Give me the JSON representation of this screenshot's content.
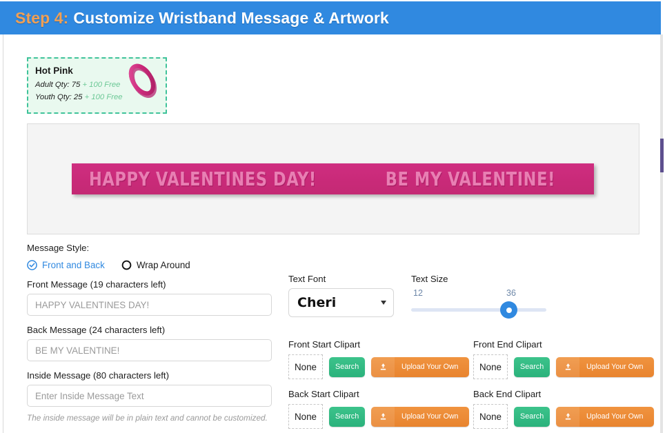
{
  "header": {
    "step_label": "Step 4:",
    "title": "Customize Wristband Message & Artwork",
    "bar_color": "#3089e0",
    "step_color": "#f0a055"
  },
  "color_card": {
    "name": "Hot Pink",
    "swatch_color": "#ce2d7f",
    "adult_label": "Adult Qty: 75",
    "adult_free": " + 100 Free",
    "youth_label": "Youth Qty: 25",
    "youth_free": " + 100 Free",
    "icon": "wristband-ring-icon"
  },
  "preview": {
    "band_color": "#ce2d7f",
    "text_color": "#e87fb3",
    "front_text": "HAPPY VALENTINES DAY!",
    "back_text": "BE MY VALENTINE!"
  },
  "message_style": {
    "label": "Message Style:",
    "options": [
      {
        "label": "Front and Back",
        "selected": true,
        "icon": "check-circle-icon"
      },
      {
        "label": "Wrap Around",
        "selected": false,
        "icon": "radio-empty-icon"
      }
    ]
  },
  "fields": {
    "front": {
      "label": "Front Message (19 characters left)",
      "placeholder": "HAPPY VALENTINES DAY!",
      "value": ""
    },
    "back": {
      "label": "Back Message (24 characters left)",
      "placeholder": "BE MY VALENTINE!",
      "value": ""
    },
    "inside": {
      "label": "Inside Message (80 characters left)",
      "placeholder": "Enter Inside Message Text",
      "value": ""
    },
    "inside_note": "The inside message will be in plain text and cannot be customized."
  },
  "text_font": {
    "label": "Text Font",
    "selected": "Cheri",
    "arrow_icon": "chevron-down-icon"
  },
  "text_size": {
    "label": "Text Size",
    "min": "12",
    "value": "36",
    "thumb_color": "#3089e0",
    "track_color": "#dde5f4"
  },
  "clipart": {
    "search_label": "Search",
    "upload_label": "Upload Your Own",
    "none_label": "None",
    "upload_icon": "upload-icon",
    "search_color": "#2bb27c",
    "upload_color": "#e8842f",
    "groups": [
      {
        "label": "Front Start Clipart",
        "value": "None"
      },
      {
        "label": "Front End Clipart",
        "value": "None"
      },
      {
        "label": "Back Start Clipart",
        "value": "None"
      },
      {
        "label": "Back End Clipart",
        "value": "None"
      }
    ]
  }
}
